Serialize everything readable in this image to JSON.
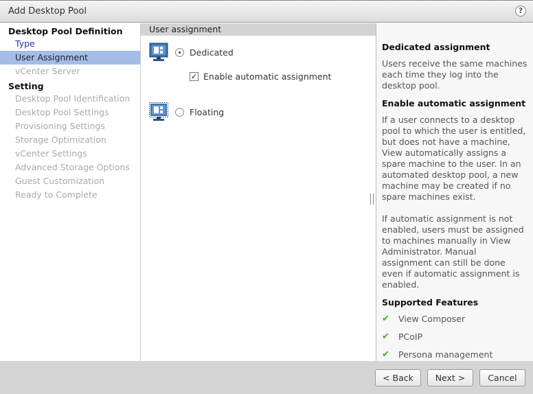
{
  "window": {
    "title": "Add Desktop Pool",
    "help_icon": "?"
  },
  "sidebar": {
    "sections": [
      {
        "label": "Desktop Pool Definition",
        "items": [
          {
            "label": "Type",
            "state": "link"
          },
          {
            "label": "User Assignment",
            "state": "active"
          },
          {
            "label": "vCenter Server",
            "state": "disabled"
          }
        ]
      },
      {
        "label": "Setting",
        "items": [
          {
            "label": "Desktop Pool Identification",
            "state": "disabled"
          },
          {
            "label": "Desktop Pool Settings",
            "state": "disabled"
          },
          {
            "label": "Provisioning Settings",
            "state": "disabled"
          },
          {
            "label": "Storage Optimization",
            "state": "disabled"
          },
          {
            "label": "vCenter Settings",
            "state": "disabled"
          },
          {
            "label": "Advanced Storage Options",
            "state": "disabled"
          },
          {
            "label": "Guest Customization",
            "state": "disabled"
          },
          {
            "label": "Ready to Complete",
            "state": "disabled"
          }
        ]
      }
    ]
  },
  "main": {
    "header": "User assignment",
    "options": [
      {
        "label": "Dedicated",
        "selected": true
      },
      {
        "label": "Floating",
        "selected": false
      }
    ],
    "auto_assign": {
      "label": "Enable automatic assignment",
      "checked": true
    }
  },
  "help": {
    "h1": "Dedicated assignment",
    "p1": "Users receive the same machines each time they log into the desktop pool.",
    "h2": "Enable automatic assignment",
    "p2": "If a user connects to a desktop pool to which the user is entitled, but does not have a machine, View automatically assigns a spare machine to the user. In an automated desktop pool, a new machine may be created if no spare machines exist.",
    "p3": "If automatic assignment is not enabled, users must be assigned to machines manually in View Administrator. Manual assignment can still be done even if automatic assignment is enabled.",
    "h3": "Supported Features",
    "features": [
      "View Composer",
      "PCoIP",
      "Persona management"
    ]
  },
  "footer": {
    "back": "< Back",
    "next": "Next >",
    "cancel": "Cancel"
  },
  "colors": {
    "active_item": "#a3bde8",
    "check": "#4caa2a",
    "link": "#1a3a9a"
  }
}
